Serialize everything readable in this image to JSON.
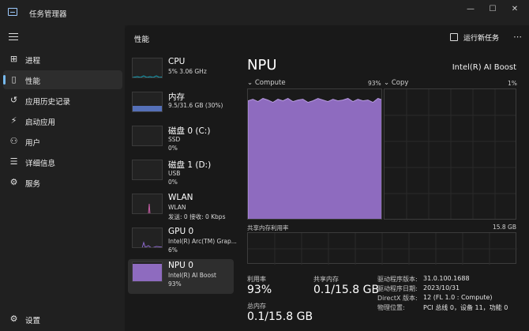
{
  "window": {
    "title": "任务管理器",
    "controls": {
      "minimize": "—",
      "maximize": "☐",
      "close": "✕"
    }
  },
  "nav": {
    "items": [
      {
        "label": "进程",
        "icon": "processes-icon",
        "glyph": "⊞"
      },
      {
        "label": "性能",
        "icon": "performance-icon",
        "glyph": "▯"
      },
      {
        "label": "应用历史记录",
        "icon": "history-icon",
        "glyph": "↺"
      },
      {
        "label": "启动应用",
        "icon": "startup-icon",
        "glyph": "⚡"
      },
      {
        "label": "用户",
        "icon": "users-icon",
        "glyph": "⚇"
      },
      {
        "label": "详细信息",
        "icon": "details-icon",
        "glyph": "☰"
      },
      {
        "label": "服务",
        "icon": "services-icon",
        "glyph": "⚙"
      }
    ],
    "settings": {
      "label": "设置",
      "glyph": "⚙"
    },
    "active_index": 1,
    "accent": "#76b9ed"
  },
  "header": {
    "title": "性能",
    "run_task": "运行新任务",
    "more": "⋯"
  },
  "devices": [
    {
      "name": "CPU",
      "line1": "5% 3.06 GHz",
      "line2": "",
      "thumb": "cpu",
      "color": "#17a2b8"
    },
    {
      "name": "内存",
      "line1": "9.5/31.6 GB (30%)",
      "line2": "",
      "thumb": "memory",
      "color": "#7a9dd9",
      "fill": 0.3
    },
    {
      "name": "磁盘 0 (C:)",
      "line1": "SSD",
      "line2": "0%",
      "thumb": "disk",
      "color": "#6fbf4a"
    },
    {
      "name": "磁盘 1 (D:)",
      "line1": "USB",
      "line2": "0%",
      "thumb": "disk",
      "color": "#6fbf4a"
    },
    {
      "name": "WLAN",
      "line1": "WLAN",
      "line2": "发送: 0 接收: 0 Kbps",
      "thumb": "wlan",
      "color": "#c85ea6"
    },
    {
      "name": "GPU 0",
      "line1": "Intel(R) Arc(TM) Grap...",
      "line2": "6%",
      "thumb": "gpu",
      "color": "#8a67c8"
    },
    {
      "name": "NPU 0",
      "line1": "Intel(R) AI Boost",
      "line2": "93%",
      "thumb": "npu",
      "color": "#8e6bbf",
      "fill": 0.93
    }
  ],
  "detail": {
    "title": "NPU",
    "model": "Intel(R) AI Boost",
    "graphs": [
      {
        "caption": "Compute",
        "pct_label": "93%",
        "level": 0.93
      },
      {
        "caption": "Copy",
        "pct_label": "1%",
        "level": 0.0
      }
    ],
    "shared_memory": {
      "caption": "共享内存利用率",
      "max": "15.8 GB"
    },
    "stats": {
      "utilization": {
        "label": "利用率",
        "value": "93%"
      },
      "shared_mem": {
        "label": "共享内存",
        "value": "0.1/15.8 GB"
      },
      "total_mem": {
        "label": "总内存",
        "value": "0.1/15.8 GB"
      }
    },
    "info": [
      {
        "key": "驱动程序版本:",
        "value": "31.0.100.1688"
      },
      {
        "key": "驱动程序日期:",
        "value": "2023/10/31"
      },
      {
        "key": "DirectX 版本:",
        "value": "12 (FL 1.0 : Compute)"
      },
      {
        "key": "物理位置:",
        "value": "PCI 总线 0，设备 11，功能 0"
      }
    ],
    "graph_color": "#8e6bbf",
    "graph_line": "#b79be0"
  }
}
